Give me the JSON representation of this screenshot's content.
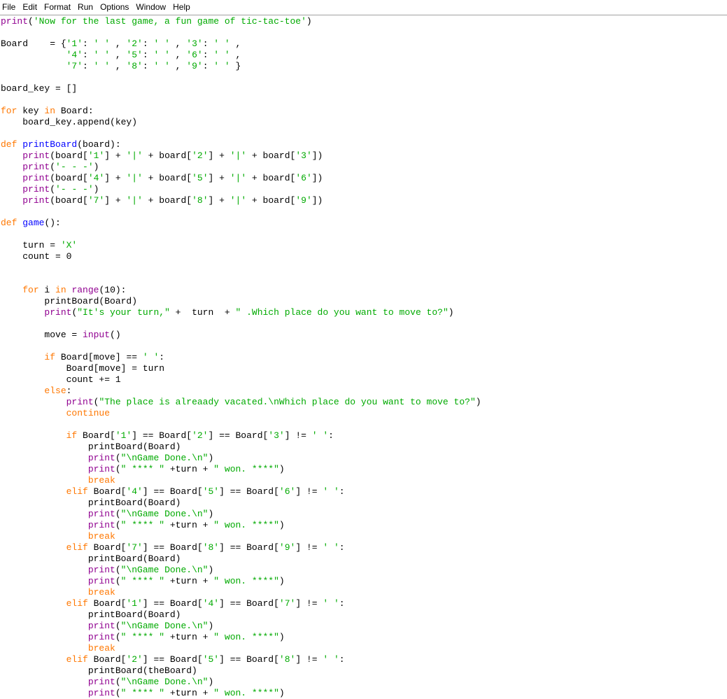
{
  "menu": {
    "items": [
      "File",
      "Edit",
      "Format",
      "Run",
      "Options",
      "Window",
      "Help"
    ]
  },
  "colors": {
    "keyword": "#ff7700",
    "string": "#00aa00",
    "builtin": "#900090",
    "definition": "#0000ff",
    "text": "#000000",
    "background": "#ffffff"
  },
  "code_lines": [
    [
      [
        "bi",
        "print"
      ],
      [
        "plain",
        "("
      ],
      [
        "str",
        "'Now for the last game, a fun game of tic-tac-toe'"
      ],
      [
        "plain",
        ")"
      ]
    ],
    [],
    [
      [
        "plain",
        "Board    = {"
      ],
      [
        "str",
        "'1'"
      ],
      [
        "plain",
        ": "
      ],
      [
        "str",
        "' '"
      ],
      [
        "plain",
        " , "
      ],
      [
        "str",
        "'2'"
      ],
      [
        "plain",
        ": "
      ],
      [
        "str",
        "' '"
      ],
      [
        "plain",
        " , "
      ],
      [
        "str",
        "'3'"
      ],
      [
        "plain",
        ": "
      ],
      [
        "str",
        "' '"
      ],
      [
        "plain",
        " ,"
      ]
    ],
    [
      [
        "plain",
        "            "
      ],
      [
        "str",
        "'4'"
      ],
      [
        "plain",
        ": "
      ],
      [
        "str",
        "' '"
      ],
      [
        "plain",
        " , "
      ],
      [
        "str",
        "'5'"
      ],
      [
        "plain",
        ": "
      ],
      [
        "str",
        "' '"
      ],
      [
        "plain",
        " , "
      ],
      [
        "str",
        "'6'"
      ],
      [
        "plain",
        ": "
      ],
      [
        "str",
        "' '"
      ],
      [
        "plain",
        " ,"
      ]
    ],
    [
      [
        "plain",
        "            "
      ],
      [
        "str",
        "'7'"
      ],
      [
        "plain",
        ": "
      ],
      [
        "str",
        "' '"
      ],
      [
        "plain",
        " , "
      ],
      [
        "str",
        "'8'"
      ],
      [
        "plain",
        ": "
      ],
      [
        "str",
        "' '"
      ],
      [
        "plain",
        " , "
      ],
      [
        "str",
        "'9'"
      ],
      [
        "plain",
        ": "
      ],
      [
        "str",
        "' '"
      ],
      [
        "plain",
        " }"
      ]
    ],
    [],
    [
      [
        "plain",
        "board_key = []"
      ]
    ],
    [],
    [
      [
        "kw",
        "for"
      ],
      [
        "plain",
        " key "
      ],
      [
        "kw",
        "in"
      ],
      [
        "plain",
        " Board:"
      ]
    ],
    [
      [
        "plain",
        "    board_key.append(key)"
      ]
    ],
    [],
    [
      [
        "kw",
        "def"
      ],
      [
        "plain",
        " "
      ],
      [
        "def",
        "printBoard"
      ],
      [
        "plain",
        "(board):"
      ]
    ],
    [
      [
        "plain",
        "    "
      ],
      [
        "bi",
        "print"
      ],
      [
        "plain",
        "(board["
      ],
      [
        "str",
        "'1'"
      ],
      [
        "plain",
        "] + "
      ],
      [
        "str",
        "'|'"
      ],
      [
        "plain",
        " + board["
      ],
      [
        "str",
        "'2'"
      ],
      [
        "plain",
        "] + "
      ],
      [
        "str",
        "'|'"
      ],
      [
        "plain",
        " + board["
      ],
      [
        "str",
        "'3'"
      ],
      [
        "plain",
        "])"
      ]
    ],
    [
      [
        "plain",
        "    "
      ],
      [
        "bi",
        "print"
      ],
      [
        "plain",
        "("
      ],
      [
        "str",
        "'- - -'"
      ],
      [
        "plain",
        ")"
      ]
    ],
    [
      [
        "plain",
        "    "
      ],
      [
        "bi",
        "print"
      ],
      [
        "plain",
        "(board["
      ],
      [
        "str",
        "'4'"
      ],
      [
        "plain",
        "] + "
      ],
      [
        "str",
        "'|'"
      ],
      [
        "plain",
        " + board["
      ],
      [
        "str",
        "'5'"
      ],
      [
        "plain",
        "] + "
      ],
      [
        "str",
        "'|'"
      ],
      [
        "plain",
        " + board["
      ],
      [
        "str",
        "'6'"
      ],
      [
        "plain",
        "])"
      ]
    ],
    [
      [
        "plain",
        "    "
      ],
      [
        "bi",
        "print"
      ],
      [
        "plain",
        "("
      ],
      [
        "str",
        "'- - -'"
      ],
      [
        "plain",
        ")"
      ]
    ],
    [
      [
        "plain",
        "    "
      ],
      [
        "bi",
        "print"
      ],
      [
        "plain",
        "(board["
      ],
      [
        "str",
        "'7'"
      ],
      [
        "plain",
        "] + "
      ],
      [
        "str",
        "'|'"
      ],
      [
        "plain",
        " + board["
      ],
      [
        "str",
        "'8'"
      ],
      [
        "plain",
        "] + "
      ],
      [
        "str",
        "'|'"
      ],
      [
        "plain",
        " + board["
      ],
      [
        "str",
        "'9'"
      ],
      [
        "plain",
        "])"
      ]
    ],
    [],
    [
      [
        "kw",
        "def"
      ],
      [
        "plain",
        " "
      ],
      [
        "def",
        "game"
      ],
      [
        "plain",
        "():"
      ]
    ],
    [],
    [
      [
        "plain",
        "    turn = "
      ],
      [
        "str",
        "'X'"
      ]
    ],
    [
      [
        "plain",
        "    count = 0"
      ]
    ],
    [],
    [],
    [
      [
        "plain",
        "    "
      ],
      [
        "kw",
        "for"
      ],
      [
        "plain",
        " i "
      ],
      [
        "kw",
        "in"
      ],
      [
        "plain",
        " "
      ],
      [
        "bi",
        "range"
      ],
      [
        "plain",
        "(10):"
      ]
    ],
    [
      [
        "plain",
        "        printBoard(Board)"
      ]
    ],
    [
      [
        "plain",
        "        "
      ],
      [
        "bi",
        "print"
      ],
      [
        "plain",
        "("
      ],
      [
        "str",
        "\"It's your turn,\""
      ],
      [
        "plain",
        " +  turn  + "
      ],
      [
        "str",
        "\" .Which place do you want to move to?\""
      ],
      [
        "plain",
        ")"
      ]
    ],
    [],
    [
      [
        "plain",
        "        move = "
      ],
      [
        "bi",
        "input"
      ],
      [
        "plain",
        "()"
      ]
    ],
    [],
    [
      [
        "plain",
        "        "
      ],
      [
        "kw",
        "if"
      ],
      [
        "plain",
        " Board[move] == "
      ],
      [
        "str",
        "' '"
      ],
      [
        "plain",
        ":"
      ]
    ],
    [
      [
        "plain",
        "            Board[move] = turn"
      ]
    ],
    [
      [
        "plain",
        "            count += 1"
      ]
    ],
    [
      [
        "plain",
        "        "
      ],
      [
        "kw",
        "else"
      ],
      [
        "plain",
        ":"
      ]
    ],
    [
      [
        "plain",
        "            "
      ],
      [
        "bi",
        "print"
      ],
      [
        "plain",
        "("
      ],
      [
        "str",
        "\"The place is alreaady vacated.\\nWhich place do you want to move to?\""
      ],
      [
        "plain",
        ")"
      ]
    ],
    [
      [
        "plain",
        "            "
      ],
      [
        "kw",
        "continue"
      ]
    ],
    [],
    [
      [
        "plain",
        "            "
      ],
      [
        "kw",
        "if"
      ],
      [
        "plain",
        " Board["
      ],
      [
        "str",
        "'1'"
      ],
      [
        "plain",
        "] == Board["
      ],
      [
        "str",
        "'2'"
      ],
      [
        "plain",
        "] == Board["
      ],
      [
        "str",
        "'3'"
      ],
      [
        "plain",
        "] != "
      ],
      [
        "str",
        "' '"
      ],
      [
        "plain",
        ":"
      ]
    ],
    [
      [
        "plain",
        "                printBoard(Board)"
      ]
    ],
    [
      [
        "plain",
        "                "
      ],
      [
        "bi",
        "print"
      ],
      [
        "plain",
        "("
      ],
      [
        "str",
        "\"\\nGame Done.\\n\""
      ],
      [
        "plain",
        ")"
      ]
    ],
    [
      [
        "plain",
        "                "
      ],
      [
        "bi",
        "print"
      ],
      [
        "plain",
        "("
      ],
      [
        "str",
        "\" **** \""
      ],
      [
        "plain",
        " +turn + "
      ],
      [
        "str",
        "\" won. ****\""
      ],
      [
        "plain",
        ")"
      ]
    ],
    [
      [
        "plain",
        "                "
      ],
      [
        "kw",
        "break"
      ]
    ],
    [
      [
        "plain",
        "            "
      ],
      [
        "kw",
        "elif"
      ],
      [
        "plain",
        " Board["
      ],
      [
        "str",
        "'4'"
      ],
      [
        "plain",
        "] == Board["
      ],
      [
        "str",
        "'5'"
      ],
      [
        "plain",
        "] == Board["
      ],
      [
        "str",
        "'6'"
      ],
      [
        "plain",
        "] != "
      ],
      [
        "str",
        "' '"
      ],
      [
        "plain",
        ":"
      ]
    ],
    [
      [
        "plain",
        "                printBoard(Board)"
      ]
    ],
    [
      [
        "plain",
        "                "
      ],
      [
        "bi",
        "print"
      ],
      [
        "plain",
        "("
      ],
      [
        "str",
        "\"\\nGame Done.\\n\""
      ],
      [
        "plain",
        ")"
      ]
    ],
    [
      [
        "plain",
        "                "
      ],
      [
        "bi",
        "print"
      ],
      [
        "plain",
        "("
      ],
      [
        "str",
        "\" **** \""
      ],
      [
        "plain",
        " +turn + "
      ],
      [
        "str",
        "\" won. ****\""
      ],
      [
        "plain",
        ")"
      ]
    ],
    [
      [
        "plain",
        "                "
      ],
      [
        "kw",
        "break"
      ]
    ],
    [
      [
        "plain",
        "            "
      ],
      [
        "kw",
        "elif"
      ],
      [
        "plain",
        " Board["
      ],
      [
        "str",
        "'7'"
      ],
      [
        "plain",
        "] == Board["
      ],
      [
        "str",
        "'8'"
      ],
      [
        "plain",
        "] == Board["
      ],
      [
        "str",
        "'9'"
      ],
      [
        "plain",
        "] != "
      ],
      [
        "str",
        "' '"
      ],
      [
        "plain",
        ":"
      ]
    ],
    [
      [
        "plain",
        "                printBoard(Board)"
      ]
    ],
    [
      [
        "plain",
        "                "
      ],
      [
        "bi",
        "print"
      ],
      [
        "plain",
        "("
      ],
      [
        "str",
        "\"\\nGame Done.\\n\""
      ],
      [
        "plain",
        ")"
      ]
    ],
    [
      [
        "plain",
        "                "
      ],
      [
        "bi",
        "print"
      ],
      [
        "plain",
        "("
      ],
      [
        "str",
        "\" **** \""
      ],
      [
        "plain",
        " +turn + "
      ],
      [
        "str",
        "\" won. ****\""
      ],
      [
        "plain",
        ")"
      ]
    ],
    [
      [
        "plain",
        "                "
      ],
      [
        "kw",
        "break"
      ]
    ],
    [
      [
        "plain",
        "            "
      ],
      [
        "kw",
        "elif"
      ],
      [
        "plain",
        " Board["
      ],
      [
        "str",
        "'1'"
      ],
      [
        "plain",
        "] == Board["
      ],
      [
        "str",
        "'4'"
      ],
      [
        "plain",
        "] == Board["
      ],
      [
        "str",
        "'7'"
      ],
      [
        "plain",
        "] != "
      ],
      [
        "str",
        "' '"
      ],
      [
        "plain",
        ":"
      ]
    ],
    [
      [
        "plain",
        "                printBoard(Board)"
      ]
    ],
    [
      [
        "plain",
        "                "
      ],
      [
        "bi",
        "print"
      ],
      [
        "plain",
        "("
      ],
      [
        "str",
        "\"\\nGame Done.\\n\""
      ],
      [
        "plain",
        ")"
      ]
    ],
    [
      [
        "plain",
        "                "
      ],
      [
        "bi",
        "print"
      ],
      [
        "plain",
        "("
      ],
      [
        "str",
        "\" **** \""
      ],
      [
        "plain",
        " +turn + "
      ],
      [
        "str",
        "\" won. ****\""
      ],
      [
        "plain",
        ")"
      ]
    ],
    [
      [
        "plain",
        "                "
      ],
      [
        "kw",
        "break"
      ]
    ],
    [
      [
        "plain",
        "            "
      ],
      [
        "kw",
        "elif"
      ],
      [
        "plain",
        " Board["
      ],
      [
        "str",
        "'2'"
      ],
      [
        "plain",
        "] == Board["
      ],
      [
        "str",
        "'5'"
      ],
      [
        "plain",
        "] == Board["
      ],
      [
        "str",
        "'8'"
      ],
      [
        "plain",
        "] != "
      ],
      [
        "str",
        "' '"
      ],
      [
        "plain",
        ":"
      ]
    ],
    [
      [
        "plain",
        "                printBoard(theBoard)"
      ]
    ],
    [
      [
        "plain",
        "                "
      ],
      [
        "bi",
        "print"
      ],
      [
        "plain",
        "("
      ],
      [
        "str",
        "\"\\nGame Done.\\n\""
      ],
      [
        "plain",
        ")"
      ]
    ],
    [
      [
        "plain",
        "                "
      ],
      [
        "bi",
        "print"
      ],
      [
        "plain",
        "("
      ],
      [
        "str",
        "\" **** \""
      ],
      [
        "plain",
        " +turn + "
      ],
      [
        "str",
        "\" won. ****\""
      ],
      [
        "plain",
        ")"
      ]
    ]
  ]
}
